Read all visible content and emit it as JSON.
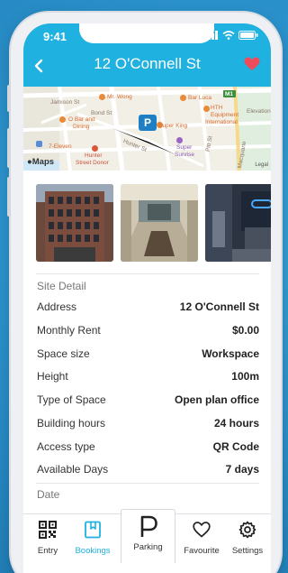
{
  "status_bar": {
    "time": "9:41"
  },
  "header": {
    "title": "12 O'Connell St"
  },
  "map": {
    "attribution": "Maps",
    "legal": "Legal",
    "pin_letter": "P",
    "labels": [
      "Jamison St",
      "Mr. Wong",
      "Bar Luca",
      "M1",
      "Bond St",
      "O Bar and",
      "Dining",
      "Super King",
      "HTH",
      "Equipment",
      "International",
      "Elevation",
      "Hunter",
      "Street Donor",
      "Hunter St",
      "Super",
      "Sunrise",
      "Pitt St",
      "Macquarie",
      "7-Eleven"
    ]
  },
  "gallery": {
    "photos": [
      "building-exterior",
      "lobby",
      "office-interior"
    ]
  },
  "site_detail": {
    "heading": "Site Detail",
    "rows": [
      {
        "label": "Address",
        "value": "12 O'Connell St"
      },
      {
        "label": "Monthly Rent",
        "value": "$0.00"
      },
      {
        "label": "Space size",
        "value": "Workspace"
      },
      {
        "label": "Height",
        "value": "100m"
      },
      {
        "label": "Type of Space",
        "value": "Open plan office"
      },
      {
        "label": "Building hours",
        "value": "24 hours"
      },
      {
        "label": "Access type",
        "value": "QR Code"
      },
      {
        "label": "Available Days",
        "value": "7 days"
      }
    ]
  },
  "date_section": {
    "heading": "Date"
  },
  "tabs": {
    "entry": "Entry",
    "bookings": "Bookings",
    "parking": "Parking",
    "favourite": "Favourite",
    "settings": "Settings"
  },
  "colors": {
    "accent": "#1fb1df",
    "heart": "#ef4b5a",
    "background": "#2a8fc9"
  },
  "icons": {
    "status": [
      "signal-icon",
      "wifi-icon",
      "battery-icon"
    ],
    "header": [
      "back-arrow-icon",
      "heart-icon"
    ],
    "tabs": [
      "qr-code-icon",
      "bookmark-icon",
      "parking-icon",
      "heart-outline-icon",
      "gear-icon"
    ]
  }
}
